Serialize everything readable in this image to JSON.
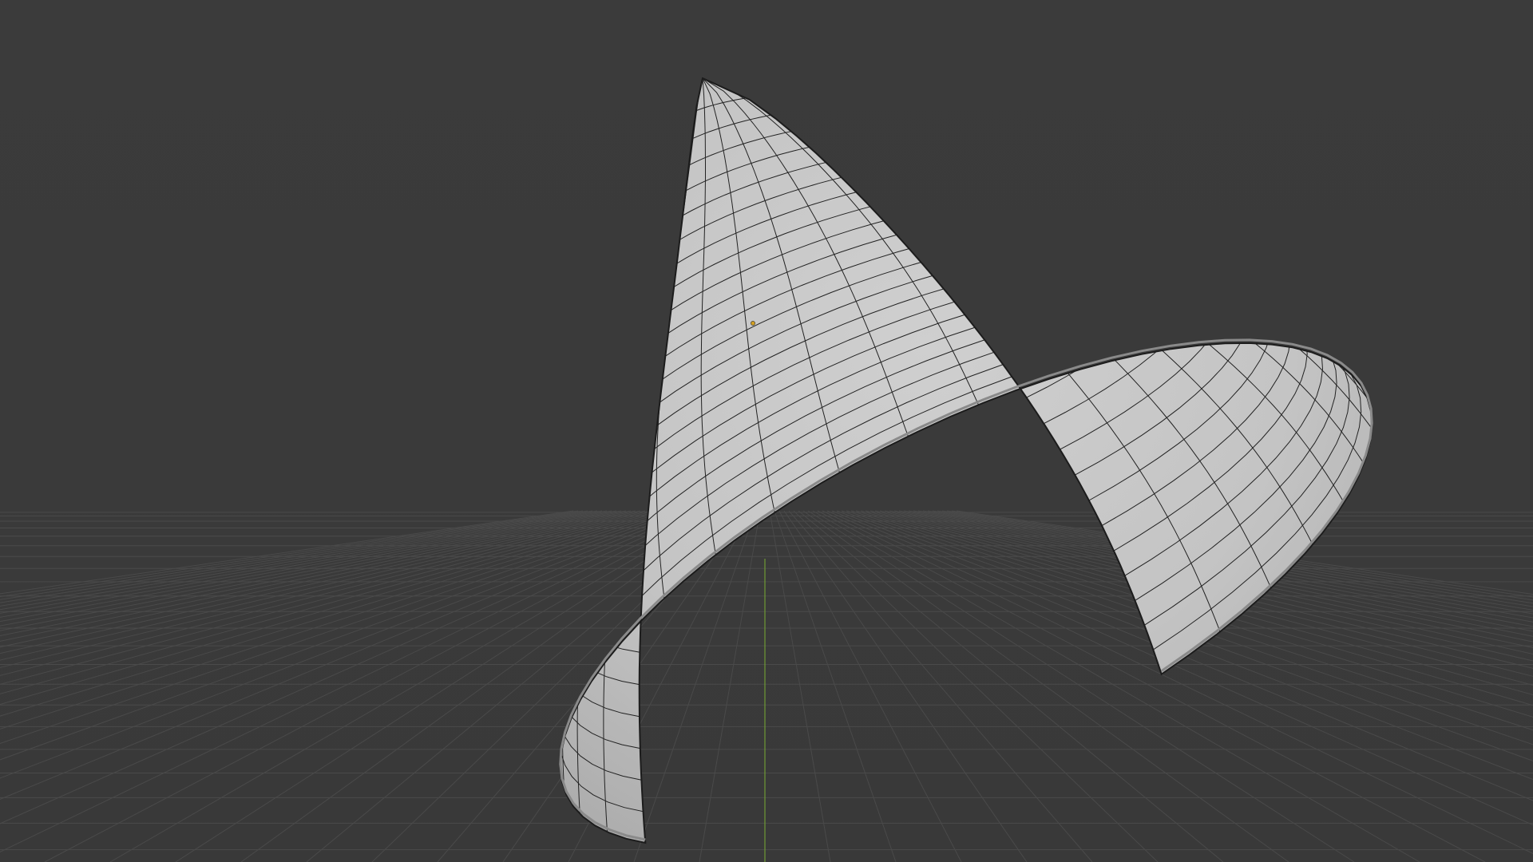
{
  "viewport": {
    "background_color": "#3a3a3a",
    "floor_grid_color": "#4a4a4a",
    "y_axis_color": "#6f9a35",
    "origin_color": "#d4a020"
  },
  "object": {
    "shape": "bell",
    "surface_color": "#c8c8c8",
    "wire_color": "#222222"
  }
}
